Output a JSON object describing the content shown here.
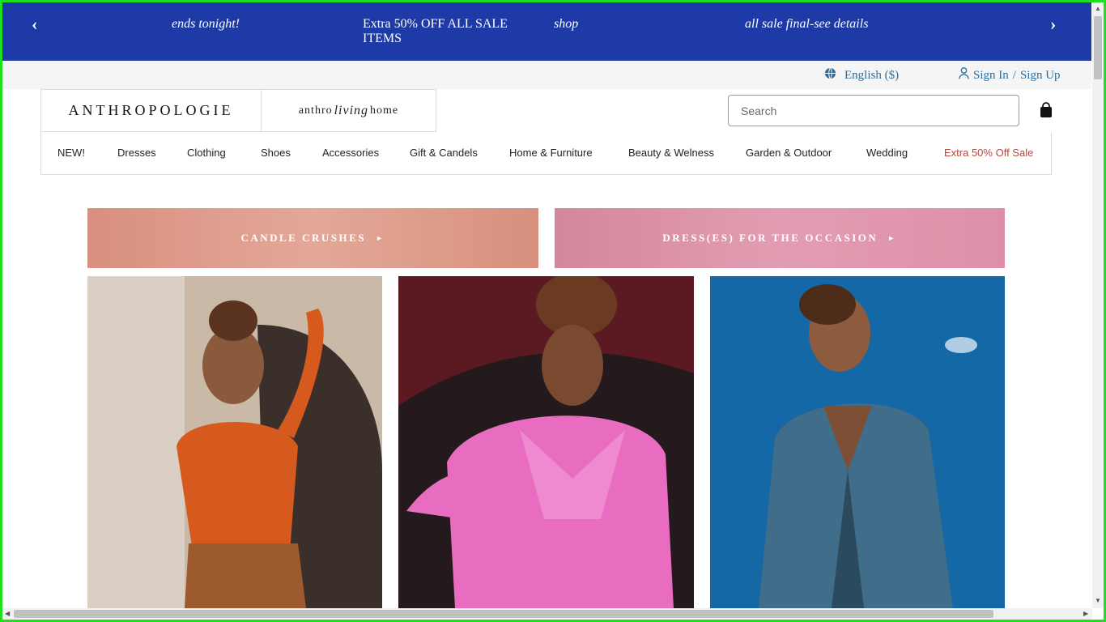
{
  "promo": {
    "prev_arrow": "‹",
    "next_arrow": "›",
    "messages": [
      "ends tonight!",
      "Extra 50% OFF ALL SALE ITEMS",
      "shop",
      "all sale final-see details"
    ]
  },
  "utility": {
    "language": "English ($)",
    "sign_in": "Sign In",
    "separator": "/",
    "sign_up": "Sign Up"
  },
  "header": {
    "logo_primary": "ANTHROPOLOGIE",
    "logo_secondary_pre": "anthro",
    "logo_secondary_script": "living",
    "logo_secondary_post": "home",
    "search_placeholder": "Search"
  },
  "nav": {
    "items": [
      "NEW!",
      "Dresses",
      "Clothing",
      "Shoes",
      "Accessories",
      "Gift & Candels",
      "Home & Furniture",
      "Beauty & Welness",
      "Garden & Outdoor",
      "Wedding",
      "Extra 50% Off Sale"
    ]
  },
  "tiles": [
    {
      "label": "CANDLE CRUSHES",
      "arrow": "►"
    },
    {
      "label": "DRESS(ES) FOR THE OCCASION",
      "arrow": "►"
    }
  ],
  "colors": {
    "promo_bg": "#1e3aa6",
    "link": "#2a6fa0",
    "sale": "#b34a3c"
  }
}
